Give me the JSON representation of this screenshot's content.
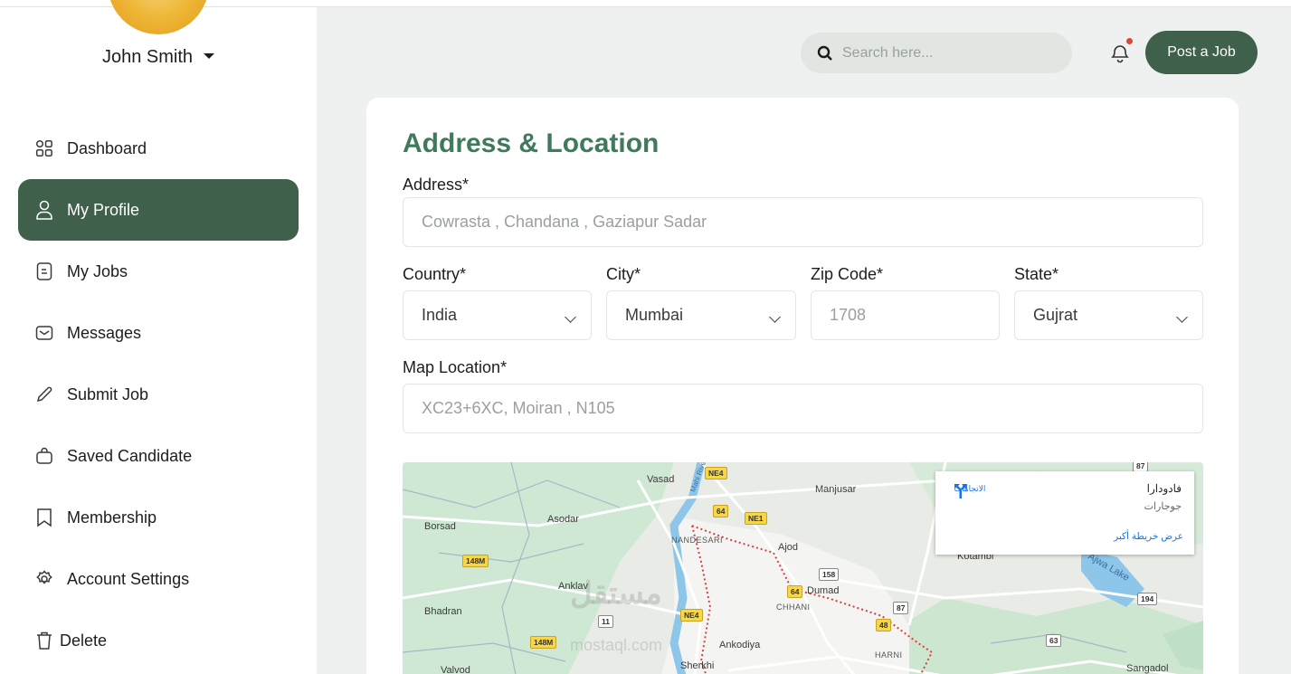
{
  "user": {
    "name": "John Smith"
  },
  "nav": {
    "items": [
      {
        "label": "Dashboard",
        "icon": "grid-icon"
      },
      {
        "label": "My Profile",
        "icon": "user-icon",
        "active": true
      },
      {
        "label": "My Jobs",
        "icon": "document-icon"
      },
      {
        "label": "Messages",
        "icon": "envelope-icon"
      },
      {
        "label": "Submit Job",
        "icon": "pencil-icon"
      },
      {
        "label": "Saved Candidate",
        "icon": "bag-icon"
      },
      {
        "label": "Membership",
        "icon": "bookmark-icon"
      },
      {
        "label": "Account Settings",
        "icon": "gear-icon"
      },
      {
        "label": "Delete",
        "icon": "trash-icon"
      }
    ]
  },
  "header": {
    "search_placeholder": "Search here...",
    "post_job_label": "Post a Job",
    "accent": "#3f604a",
    "notification_dot_color": "#e0453a"
  },
  "form": {
    "title": "Address & Location",
    "title_color": "#3f7a5b",
    "address": {
      "label": "Address*",
      "placeholder": "Cowrasta , Chandana , Gaziapur Sadar"
    },
    "country": {
      "label": "Country*",
      "value": "India"
    },
    "city": {
      "label": "City*",
      "value": "Mumbai"
    },
    "zip": {
      "label": "Zip Code*",
      "placeholder": "1708"
    },
    "state": {
      "label": "State*",
      "value": "Gujrat"
    },
    "map_location": {
      "label": "Map Location*",
      "placeholder": "XC23+6XC, Moiran , N105"
    }
  },
  "map": {
    "places": [
      "Vasad",
      "Manjusar",
      "Borsad",
      "Asodar",
      "NANDESARI",
      "Ajod",
      "Kotambi",
      "Anklav",
      "Dumad",
      "CHHANI",
      "Ajwa Lake",
      "Bhadran",
      "Ankodiya",
      "HARNI",
      "Sherkhi",
      "Valvod",
      "Sangadol",
      "Mahi River"
    ],
    "shields": [
      "NE4",
      "64",
      "NE1",
      "148M",
      "158",
      "64",
      "87",
      "48",
      "11",
      "NE4",
      "148M",
      "63",
      "194",
      "87"
    ],
    "info_card": {
      "place_name": "فادودارا",
      "region": "جوجارات",
      "directions_label": "الاتجاهات",
      "larger_map_link": "عرض خريطة أكبر"
    },
    "watermark": "مستقل",
    "watermark_sub": "mostaql.com"
  }
}
